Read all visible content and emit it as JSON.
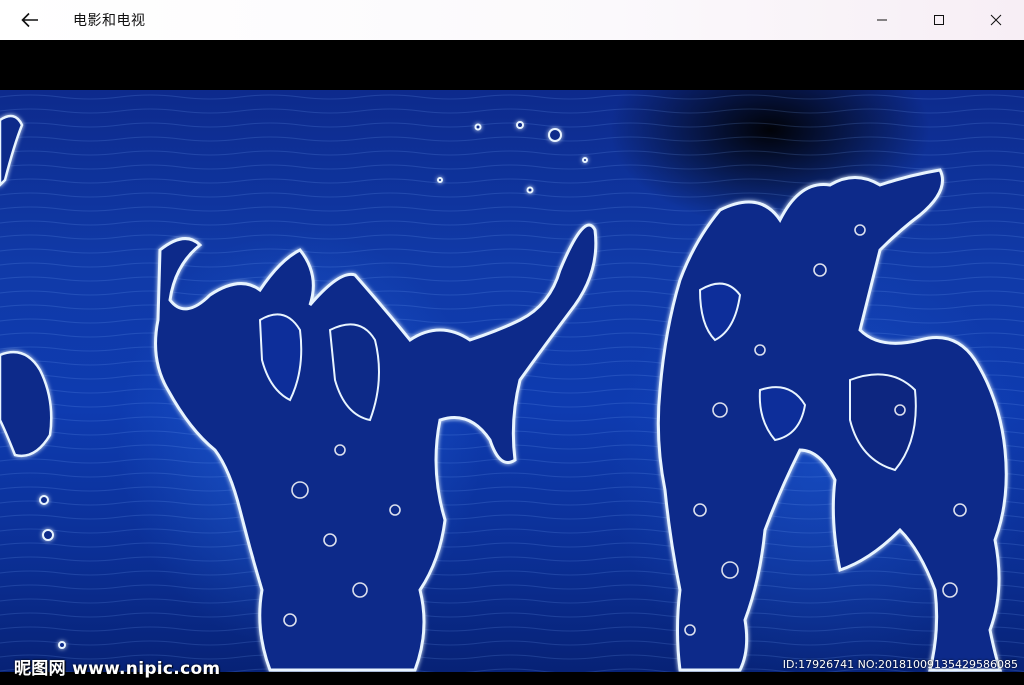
{
  "window": {
    "title": "电影和电视",
    "back_icon": "arrow-left-icon",
    "minimize_icon": "minimize-icon",
    "maximize_icon": "maximize-icon",
    "close_icon": "close-icon"
  },
  "video": {
    "watermark_left": "昵图网 www.nipic.com",
    "watermark_right": "ID:17926741 NO:20181009135429586085"
  }
}
